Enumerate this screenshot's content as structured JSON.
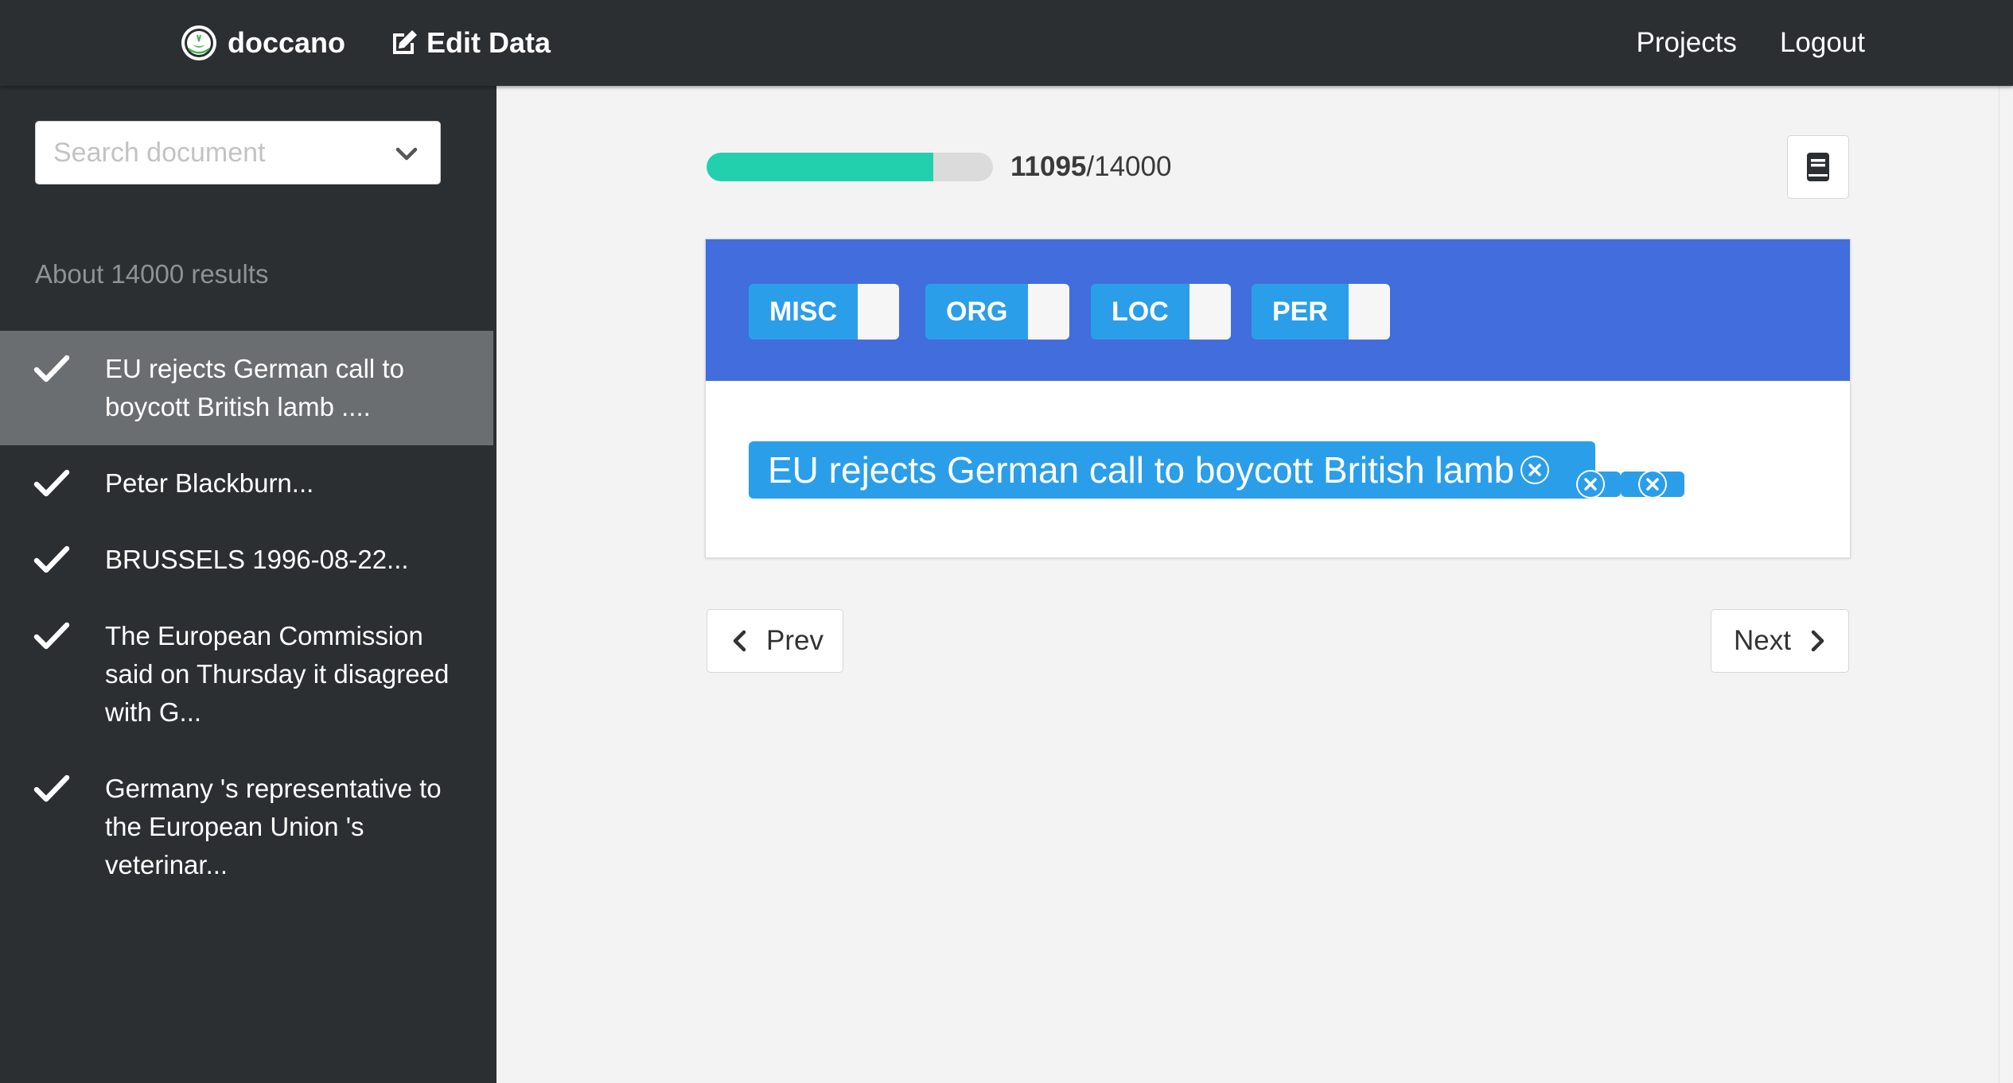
{
  "navbar": {
    "brand": "doccano",
    "edit_data": "Edit Data",
    "links": [
      "Projects",
      "Logout"
    ]
  },
  "sidebar": {
    "search_placeholder": "Search document",
    "result_count": "About 14000 results",
    "documents": [
      {
        "text": "EU rejects German call to boycott British lamb ....",
        "done": true,
        "active": true
      },
      {
        "text": "Peter Blackburn...",
        "done": true,
        "active": false
      },
      {
        "text": "BRUSSELS 1996-08-22...",
        "done": true,
        "active": false
      },
      {
        "text": "The European Commission said on Thursday it disagreed with G...",
        "done": true,
        "active": false
      },
      {
        "text": "Germany 's representative to the European Union 's veterinar...",
        "done": true,
        "active": false
      }
    ]
  },
  "progress": {
    "done": "11095",
    "total": "/14000",
    "fraction": 0.7925
  },
  "labels": [
    "MISC",
    "ORG",
    "LOC",
    "PER"
  ],
  "annotation": {
    "text": "EU rejects German call to boycott British lamb ."
  },
  "buttons": {
    "prev": "Prev",
    "next": "Next"
  },
  "colors": {
    "navbar": "#2b2f31",
    "label_header": "#426ddc",
    "label_tag": "#2b9ee9",
    "progress": "#22d0ae",
    "active_item": "#6b6e70"
  },
  "icons": {
    "brand": "doccano-logo-icon",
    "edit": "edit-icon",
    "search_toggle": "chevron-down-icon",
    "done": "checkmark-icon",
    "guideline": "book-icon",
    "prev": "chevron-left-icon",
    "next": "chevron-right-icon",
    "delete": "close-circle-icon"
  }
}
